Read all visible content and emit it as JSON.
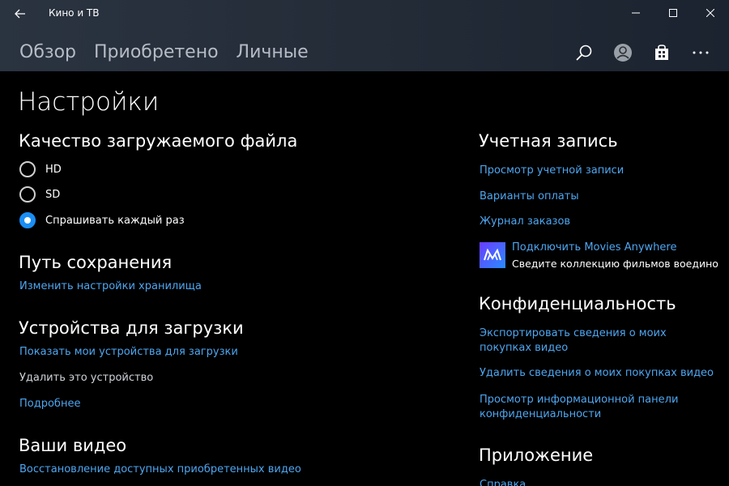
{
  "window": {
    "title": "Кино и ТВ"
  },
  "nav": {
    "items": [
      "Обзор",
      "Приобретено",
      "Личные"
    ]
  },
  "icons": {
    "back": "back-arrow-icon",
    "search": "search-icon",
    "account": "account-icon",
    "store": "store-icon",
    "more": "more-icon"
  },
  "page": {
    "title": "Настройки"
  },
  "download_quality": {
    "title": "Качество загружаемого файла",
    "options": [
      "HD",
      "SD",
      "Спрашивать каждый раз"
    ],
    "selected": "Спрашивать каждый раз"
  },
  "save_path": {
    "title": "Путь сохранения",
    "link": "Изменить настройки хранилища"
  },
  "download_devices": {
    "title": "Устройства для загрузки",
    "show_link": "Показать мои устройства для загрузки",
    "remove_text": "Удалить это устройство",
    "more_link": "Подробнее"
  },
  "your_videos": {
    "title": "Ваши видео",
    "restore_link": "Восстановление доступных приобретенных видео"
  },
  "account": {
    "title": "Учетная запись",
    "view_link": "Просмотр учетной записи",
    "payment_link": "Варианты оплаты",
    "orders_link": "Журнал заказов",
    "ma_link": "Подключить Movies Anywhere",
    "ma_desc": "Сведите коллекцию фильмов воедино"
  },
  "privacy": {
    "title": "Конфиденциальность",
    "export_link": "Экспортировать сведения о моих покупках видео",
    "delete_link": "Удалить сведения о моих покупках видео",
    "dashboard_link": "Просмотр информационной панели конфиденциальности"
  },
  "app_section": {
    "title": "Приложение",
    "help_link": "Справка"
  },
  "colors": {
    "accent": "#1a8ef5",
    "link": "#4ea6f0",
    "background": "#000000",
    "header": "#262e3a"
  }
}
